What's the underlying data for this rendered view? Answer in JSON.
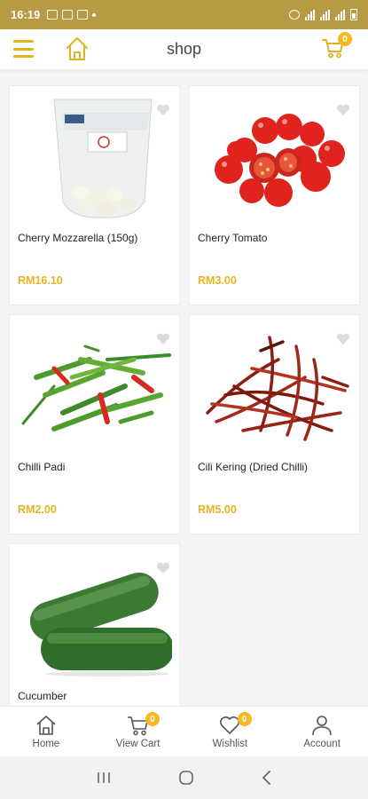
{
  "status_bar": {
    "time": "16:19"
  },
  "header": {
    "title": "shop",
    "cart_badge": "0"
  },
  "products": [
    {
      "name": "Cherry Mozzarella (150g)",
      "price": "RM16.10",
      "image": "mozzarella-image"
    },
    {
      "name": "Cherry Tomato",
      "price": "RM3.00",
      "image": "tomato-image"
    },
    {
      "name": "Chilli Padi",
      "price": "RM2.00",
      "image": "chilli-image"
    },
    {
      "name": "Cili Kering (Dried Chilli)",
      "price": "RM5.00",
      "image": "dried-chilli-image"
    },
    {
      "name": "Cucumber",
      "price": "",
      "image": "cucumber-image"
    }
  ],
  "bottom_nav": {
    "home": "Home",
    "view_cart": "View Cart",
    "view_cart_badge": "0",
    "wishlist": "Wishlist",
    "wishlist_badge": "0",
    "account": "Account"
  },
  "colors": {
    "accent": "#e9b220",
    "status_bar": "#b89a45"
  }
}
